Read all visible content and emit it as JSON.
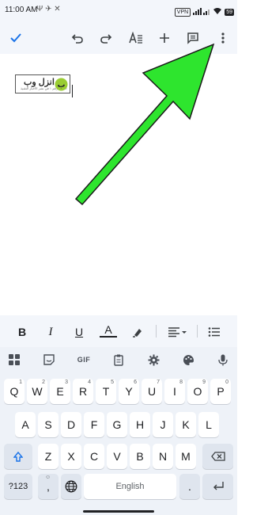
{
  "status_bar": {
    "time": "11:00 AM",
    "extra": "Ψ ✈ ✕",
    "vpn": "VPN",
    "battery": "59"
  },
  "top_toolbar": {
    "icons": [
      "check-icon",
      "undo-icon",
      "redo-icon",
      "text-format-icon",
      "add-icon",
      "comment-icon",
      "more-vert-icon"
    ]
  },
  "document": {
    "logo_title": "انزل وب",
    "logo_subtitle": "الموقع رقم ١ في نشر الأخبار التقنية"
  },
  "format_bar": {
    "bold": "B",
    "italic": "I",
    "underline": "U",
    "text_color": "A",
    "accent_color": "#1a73e8"
  },
  "keyboard": {
    "gif": "GIF",
    "row1": [
      "Q",
      "W",
      "E",
      "R",
      "T",
      "Y",
      "U",
      "I",
      "O",
      "P"
    ],
    "row1_hints": [
      "1",
      "2",
      "3",
      "4",
      "5",
      "6",
      "7",
      "8",
      "9",
      "0"
    ],
    "row2": [
      "A",
      "S",
      "D",
      "F",
      "G",
      "H",
      "J",
      "K",
      "L"
    ],
    "row3": [
      "Z",
      "X",
      "C",
      "V",
      "B",
      "N",
      "M"
    ],
    "symbols": "?123",
    "comma": ",",
    "space": "English",
    "period": "."
  }
}
